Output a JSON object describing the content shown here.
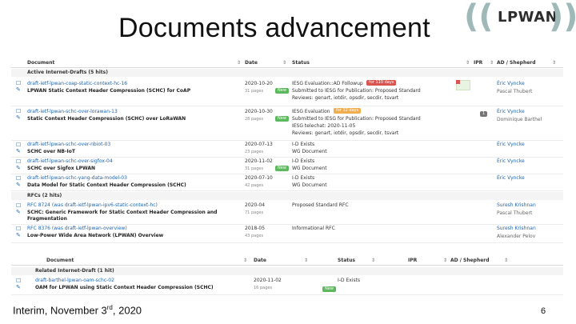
{
  "slide": {
    "title": "Documents advancement",
    "footer_prefix": "Interim, November 3",
    "footer_sup": "rd",
    "footer_suffix": ", 2020",
    "page_number": "6"
  },
  "logo": {
    "text": "LPWAN",
    "left_paren": "((",
    "right_paren": "))"
  },
  "table1": {
    "headers": {
      "document": "Document",
      "date": "Date",
      "status": "Status",
      "ipr": "IPR",
      "ad": "AD / Shepherd",
      "sort": "⇕"
    },
    "groups": {
      "active": "Active Internet-Drafts (5 hits)",
      "rfcs": "RFCs (2 hits)"
    },
    "active_rows": [
      {
        "name": "draft-ietf-lpwan-coap-static-context-hc-16",
        "title": "LPWAN Static Context Header Compression (SCHC) for CoAP",
        "date": "2020-10-20",
        "pages": "31 pages",
        "new_badge": "New",
        "status1": "IESG Evaluation::AD Followup",
        "badge": "for 110 days",
        "status2": "Submitted to IESG for Publication: Proposed Standard",
        "status3": "Reviews: genart, iotdir, opsdir, secdir, tsvart",
        "ad": "Éric Vyncke",
        "shepherd": "Pascal Thubert"
      },
      {
        "name": "draft-ietf-lpwan-schc-over-lorawan-13",
        "title": "Static Context Header Compression (SCHC) over LoRaWAN",
        "date": "2020-10-30",
        "pages": "28 pages",
        "new_badge": "New",
        "status1": "IESG Evaluation",
        "badge": "for 12 days",
        "status2": "Submitted to IESG for Publication: Proposed Standard",
        "status3": "IESG telechat: 2020-11-05",
        "status4": "Reviews: genart, iotdir, opsdir, secdir, tsvart",
        "ipr": "1",
        "ad": "Éric Vyncke",
        "shepherd": "Dominique Barthel"
      },
      {
        "name": "draft-ietf-lpwan-schc-over-nbiot-03",
        "title": "SCHC over NB-IoT",
        "date": "2020-07-13",
        "pages": "23 pages",
        "status1": "I-D Exists",
        "status2": "WG Document",
        "ad": "Éric Vyncke"
      },
      {
        "name": "draft-ietf-lpwan-schc-over-sigfox-04",
        "title": "SCHC over Sigfox LPWAN",
        "date": "2020-11-02",
        "pages": "31 pages",
        "new_badge": "New",
        "status1": "I-D Exists",
        "status2": "WG Document",
        "ad": "Éric Vyncke"
      },
      {
        "name": "draft-ietf-lpwan-schc-yang-data-model-03",
        "title": "Data Model for Static Context Header Compression (SCHC)",
        "date": "2020-07-10",
        "pages": "42 pages",
        "status1": "I-D Exists",
        "status2": "WG Document",
        "ad": "Éric Vyncke"
      }
    ],
    "rfc_rows": [
      {
        "name": "RFC 8724 (was draft-ietf-lpwan-ipv6-static-context-hc)",
        "title": "SCHC: Generic Framework for Static Context Header Compression and",
        "title2": "Fragmentation",
        "date": "2020-04",
        "pages": "71 pages",
        "status1": "Proposed Standard RFC",
        "ad": "Suresh Krishnan",
        "shepherd": "Pascal Thubert"
      },
      {
        "name": "RFC 8376 (was draft-ietf-lpwan-overview)",
        "title": "Low-Power Wide Area Network (LPWAN) Overview",
        "date": "2018-05",
        "pages": "43 pages",
        "status1": "Informational RFC",
        "ad": "Suresh Krishnan",
        "shepherd": "Alexander Pelov"
      }
    ]
  },
  "table2": {
    "headers": {
      "document": "Document",
      "date": "Date",
      "status": "Status",
      "ipr": "IPR",
      "ad": "AD / Shepherd",
      "sort": "⇕"
    },
    "group": "Related Internet-Draft (1 hit)",
    "row": {
      "name": "draft-barthel-lpwan-oam-schc-02",
      "title": "OAM for LPWAN using Static Context Header Compression (SCHC)",
      "date": "2020-11-02",
      "pages": "16 pages",
      "new_badge": "New",
      "status1": "I-D Exists"
    }
  }
}
